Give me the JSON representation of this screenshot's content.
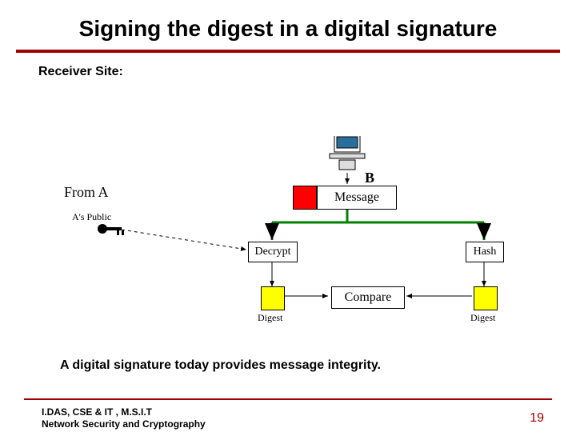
{
  "title": "Signing the digest in a digital signature",
  "sub": "Receiver Site:",
  "diagram": {
    "from": "From A",
    "pub": "A's Public",
    "receiver": "B",
    "message": "Message",
    "decrypt": "Decrypt",
    "hash": "Hash",
    "compare": "Compare",
    "digest_l": "Digest",
    "digest_r": "Digest"
  },
  "caption": "A digital signature today provides message integrity.",
  "footer_line1": "I.DAS, CSE & IT , M.S.I.T",
  "footer_line2": "Network Security and Cryptography",
  "page": "19"
}
